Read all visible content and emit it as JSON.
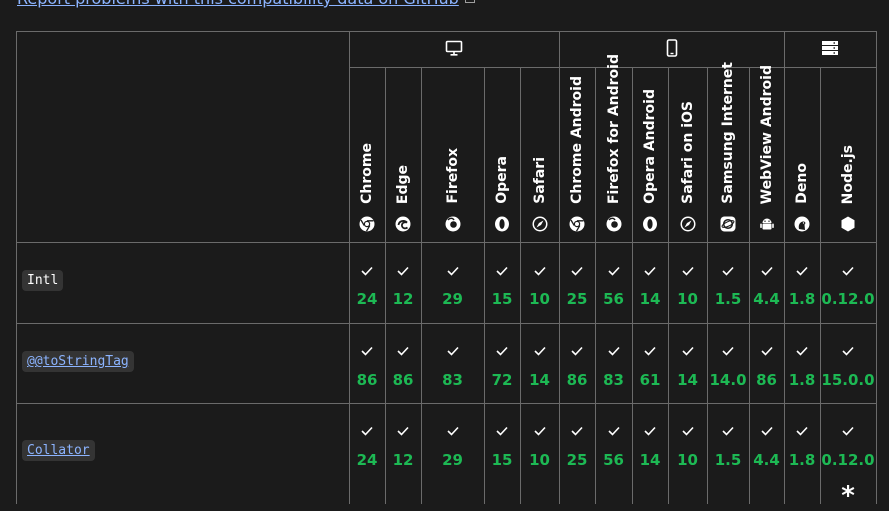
{
  "report_link": {
    "text": "Report problems with this compatibility data on GitHub"
  },
  "platform_groups": [
    {
      "name": "desktop",
      "icon": "desktop-icon"
    },
    {
      "name": "mobile",
      "icon": "mobile-icon"
    },
    {
      "name": "server",
      "icon": "server-icon"
    }
  ],
  "browsers": [
    {
      "name": "Chrome",
      "icon": "chrome-icon"
    },
    {
      "name": "Edge",
      "icon": "edge-icon"
    },
    {
      "name": "Firefox",
      "icon": "firefox-icon"
    },
    {
      "name": "Opera",
      "icon": "opera-icon"
    },
    {
      "name": "Safari",
      "icon": "safari-icon"
    },
    {
      "name": "Chrome Android",
      "icon": "chrome-icon"
    },
    {
      "name": "Firefox for Android",
      "icon": "firefox-icon"
    },
    {
      "name": "Opera Android",
      "icon": "opera-icon"
    },
    {
      "name": "Safari on iOS",
      "icon": "safari-icon"
    },
    {
      "name": "Samsung Internet",
      "icon": "samsung-internet-icon"
    },
    {
      "name": "WebView Android",
      "icon": "android-icon"
    },
    {
      "name": "Deno",
      "icon": "deno-icon"
    },
    {
      "name": "Node.js",
      "icon": "nodejs-icon"
    }
  ],
  "features": [
    {
      "label": "Intl",
      "is_link": false,
      "versions": [
        "24",
        "12",
        "29",
        "15",
        "10",
        "25",
        "56",
        "14",
        "10",
        "1.5",
        "4.4",
        "1.8",
        "0.12.0"
      ]
    },
    {
      "label": "@@toStringTag",
      "is_link": true,
      "versions": [
        "86",
        "86",
        "83",
        "72",
        "14",
        "86",
        "83",
        "61",
        "14",
        "14.0",
        "86",
        "1.8",
        "15.0.0"
      ]
    },
    {
      "label": "Collator",
      "is_link": true,
      "versions": [
        "24",
        "12",
        "29",
        "15",
        "10",
        "25",
        "56",
        "14",
        "10",
        "1.5",
        "4.4",
        "1.8",
        "0.12.0"
      ],
      "note_marker": "*"
    }
  ],
  "colors": {
    "supported": "#1db954",
    "link": "#8cb4ff",
    "border": "#6b6b6b",
    "background": "#1b1b1b"
  }
}
